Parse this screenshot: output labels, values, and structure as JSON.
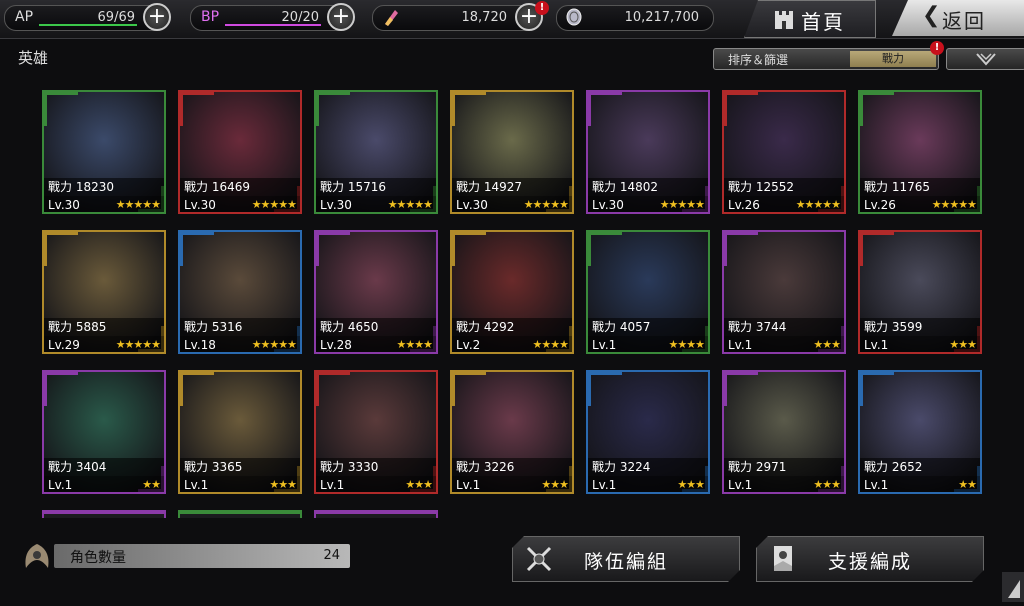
{
  "topbar": {
    "ap": {
      "label": "AP",
      "value": "69/69",
      "bar_color": "#3cc84a",
      "fill": 1.0
    },
    "bp": {
      "label": "BP",
      "value": "20/20",
      "bar_color": "#d04ae0",
      "fill": 1.0
    },
    "gems": {
      "value": "18,720",
      "icon": "gem-icon",
      "alert": "!"
    },
    "gold": {
      "value": "10,217,700",
      "icon": "coin-icon"
    },
    "home_label": "首頁",
    "back_label": "返回"
  },
  "section": {
    "title": "英雄",
    "sort_label": "排序＆篩選",
    "sort_value": "戰力",
    "sort_alert": "!",
    "filter_icon": "filter-icon"
  },
  "cards": [
    {
      "power": "戰力 18230",
      "level": "Lv.30",
      "stars": "★★★★★",
      "frame": "#3a8a3a",
      "bg": "#3b4a6a"
    },
    {
      "power": "戰力 16469",
      "level": "Lv.30",
      "stars": "★★★★★",
      "frame": "#b02a2a",
      "bg": "#6a2a3a"
    },
    {
      "power": "戰力 15716",
      "level": "Lv.30",
      "stars": "★★★★★",
      "frame": "#3a8a3a",
      "bg": "#4a4a6a"
    },
    {
      "power": "戰力 14927",
      "level": "Lv.30",
      "stars": "★★★★★",
      "frame": "#b08a2a",
      "bg": "#6a6a4a"
    },
    {
      "power": "戰力 14802",
      "level": "Lv.30",
      "stars": "★★★★★",
      "frame": "#8a3aa8",
      "bg": "#4a3a5a"
    },
    {
      "power": "戰力 12552",
      "level": "Lv.26",
      "stars": "★★★★★",
      "frame": "#b02a2a",
      "bg": "#3a2a4a"
    },
    {
      "power": "戰力 11765",
      "level": "Lv.26",
      "stars": "★★★★★",
      "frame": "#3a8a3a",
      "bg": "#6a3a5a"
    },
    {
      "power": "戰力 5885",
      "level": "Lv.29",
      "stars": "★★★★★",
      "frame": "#b08a2a",
      "bg": "#6a5a3a"
    },
    {
      "power": "戰力 5316",
      "level": "Lv.18",
      "stars": "★★★★★",
      "frame": "#2a6ab0",
      "bg": "#5a4a3a"
    },
    {
      "power": "戰力 4650",
      "level": "Lv.28",
      "stars": "★★★★",
      "frame": "#8a3aa8",
      "bg": "#6a3a4a"
    },
    {
      "power": "戰力 4292",
      "level": "Lv.2",
      "stars": "★★★★",
      "frame": "#b08a2a",
      "bg": "#6a2a2a"
    },
    {
      "power": "戰力 4057",
      "level": "Lv.1",
      "stars": "★★★★",
      "frame": "#3a8a3a",
      "bg": "#2a3a5a"
    },
    {
      "power": "戰力 3744",
      "level": "Lv.1",
      "stars": "★★★",
      "frame": "#8a3aa8",
      "bg": "#4a3a3a"
    },
    {
      "power": "戰力 3599",
      "level": "Lv.1",
      "stars": "★★★",
      "frame": "#b02a2a",
      "bg": "#4a4a5a"
    },
    {
      "power": "戰力 3404",
      "level": "Lv.1",
      "stars": "★★",
      "frame": "#8a3aa8",
      "bg": "#2a5a4a"
    },
    {
      "power": "戰力 3365",
      "level": "Lv.1",
      "stars": "★★★",
      "frame": "#b08a2a",
      "bg": "#6a5a3a"
    },
    {
      "power": "戰力 3330",
      "level": "Lv.1",
      "stars": "★★★",
      "frame": "#b02a2a",
      "bg": "#5a3a3a"
    },
    {
      "power": "戰力 3226",
      "level": "Lv.1",
      "stars": "★★★",
      "frame": "#b08a2a",
      "bg": "#6a3a4a"
    },
    {
      "power": "戰力 3224",
      "level": "Lv.1",
      "stars": "★★★",
      "frame": "#2a6ab0",
      "bg": "#2a2a4a"
    },
    {
      "power": "戰力 2971",
      "level": "Lv.1",
      "stars": "★★★",
      "frame": "#8a3aa8",
      "bg": "#5a5a4a"
    },
    {
      "power": "戰力 2652",
      "level": "Lv.1",
      "stars": "★★",
      "frame": "#2a6ab0",
      "bg": "#4a4a6a"
    }
  ],
  "partial_cards": [
    {
      "frame": "#8a3aa8"
    },
    {
      "frame": "#3a8a3a"
    },
    {
      "frame": "#8a3aa8"
    }
  ],
  "footer": {
    "count_label": "角色數量",
    "count_value": "24",
    "team_button": "隊伍編組",
    "support_button": "支援編成"
  }
}
